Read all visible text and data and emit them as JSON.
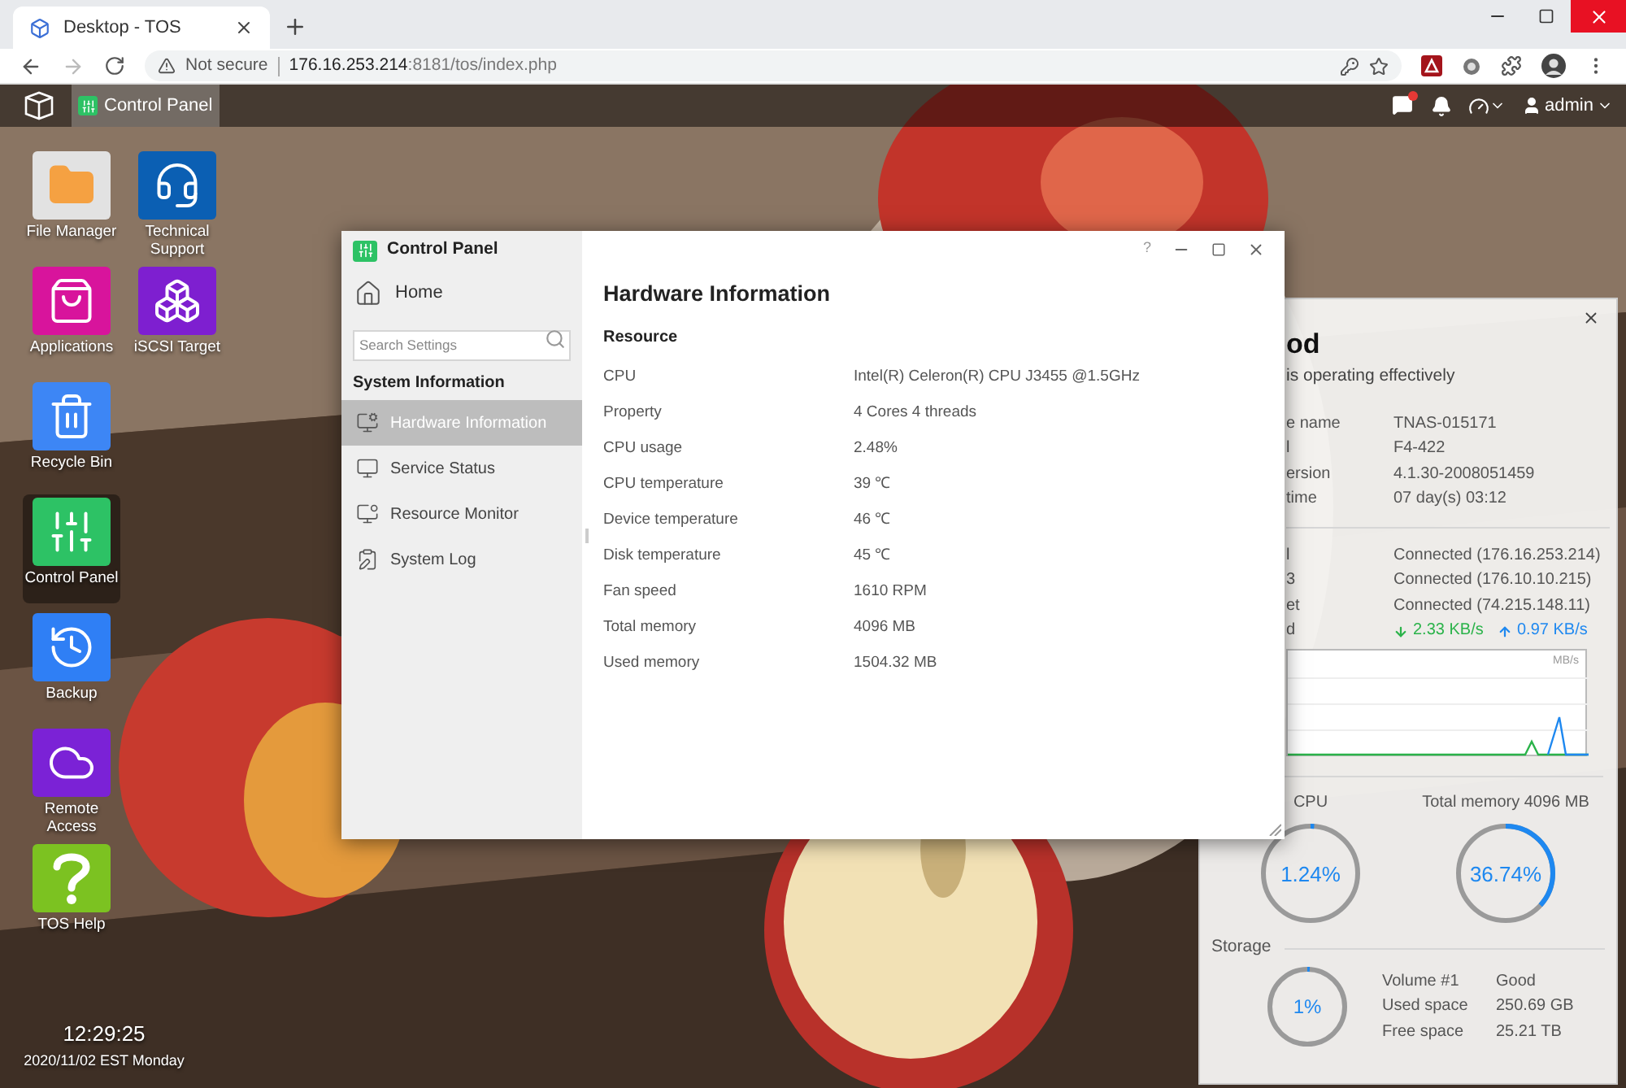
{
  "browser": {
    "tab": {
      "title": "Desktop - TOS",
      "selected": true
    },
    "address": {
      "security": "Not secure",
      "host": "176.16.253.214",
      "path": ":8181/tos/index.php"
    }
  },
  "topbar": {
    "apps": [
      {
        "label": "Control Panel",
        "selected": true
      }
    ],
    "unread": true,
    "user": "admin"
  },
  "desktop": {
    "columns": [
      [
        {
          "label": "File Manager",
          "kind": "folder",
          "color": "#e2e2e2",
          "selected": false
        },
        {
          "label": "Applications",
          "kind": "bag",
          "color": "#d8149c",
          "selected": false
        },
        {
          "label": "Recycle Bin",
          "kind": "bin",
          "color": "#3d86f5",
          "selected": false
        },
        {
          "label": "Control Panel",
          "kind": "sliders",
          "color": "#2dc265",
          "selected": true
        },
        {
          "label": "Backup",
          "kind": "backup",
          "color": "#2f7ff5",
          "selected": false
        },
        {
          "label": "Remote Access",
          "kind": "cloud",
          "color": "#7b22d6",
          "selected": false
        },
        {
          "label": "TOS Help",
          "kind": "help",
          "color": "#7cc221",
          "selected": false
        }
      ],
      [
        {
          "label": "Technical Support",
          "kind": "headset",
          "color": "#0b5fb3",
          "selected": false
        },
        {
          "label": "iSCSI Target",
          "kind": "cubes",
          "color": "#7e1fd0",
          "selected": false
        }
      ]
    ]
  },
  "clock": {
    "time": "12:29:25",
    "date": "2020/11/02 EST Monday"
  },
  "control_panel": {
    "title": "Control Panel",
    "help": "?",
    "home": "Home",
    "search": {
      "placeholder": "Search Settings"
    },
    "section": "System Information",
    "nav": [
      {
        "label": "Hardware Information",
        "kind": "hardware",
        "selected": true
      },
      {
        "label": "Service Status",
        "kind": "service",
        "selected": false
      },
      {
        "label": "Resource Monitor",
        "kind": "resource",
        "selected": false
      },
      {
        "label": "System Log",
        "kind": "log",
        "selected": false
      }
    ],
    "content": {
      "title": "Hardware Information",
      "section": "Resource",
      "rows": [
        {
          "label": "CPU",
          "value": "Intel(R) Celeron(R) CPU J3455 @1.5GHz"
        },
        {
          "label": "Property",
          "value": "4 Cores 4 threads"
        },
        {
          "label": "CPU usage",
          "value": "2.48%"
        },
        {
          "label": "CPU temperature",
          "value": "39 ℃"
        },
        {
          "label": "Device temperature",
          "value": "46 ℃"
        },
        {
          "label": "Disk temperature",
          "value": "45 ℃"
        },
        {
          "label": "Fan speed",
          "value": "1610 RPM"
        },
        {
          "label": "Total memory",
          "value": "4096 MB"
        },
        {
          "label": "Used memory",
          "value": "1504.32 MB"
        }
      ]
    }
  },
  "status_panel": {
    "heading": "od",
    "subtitle": "is operating effectively",
    "info": [
      {
        "label": "e name",
        "value": "TNAS-015171"
      },
      {
        "label": "l",
        "value": "F4-422"
      },
      {
        "label": "ersion",
        "value": "4.1.30-2008051459"
      },
      {
        "label": "time",
        "value": "07 day(s) 03:12"
      }
    ],
    "network": [
      {
        "label": "l",
        "value": "Connected (176.16.253.214)"
      },
      {
        "label": "3",
        "value": "Connected (176.10.10.215)"
      },
      {
        "label": "et",
        "value": "Connected (74.215.148.11)"
      }
    ],
    "speed": {
      "label": "d",
      "download": "2.33 KB/s",
      "upload": "0.97 KB/s"
    },
    "chart_unit": "MB/s",
    "gauges": [
      {
        "label": "CPU",
        "reading": "1.24%",
        "level": 0.0124
      },
      {
        "label": "Total memory 4096 MB",
        "reading": "36.74%",
        "level": 0.3674
      }
    ],
    "storage": {
      "title": "Storage",
      "reading": "1%",
      "level": 0.01,
      "rows": [
        {
          "label": "Volume #1",
          "value": "Good"
        },
        {
          "label": "Used space",
          "value": "250.69 GB"
        },
        {
          "label": "Free space",
          "value": "25.21 TB"
        }
      ]
    }
  }
}
